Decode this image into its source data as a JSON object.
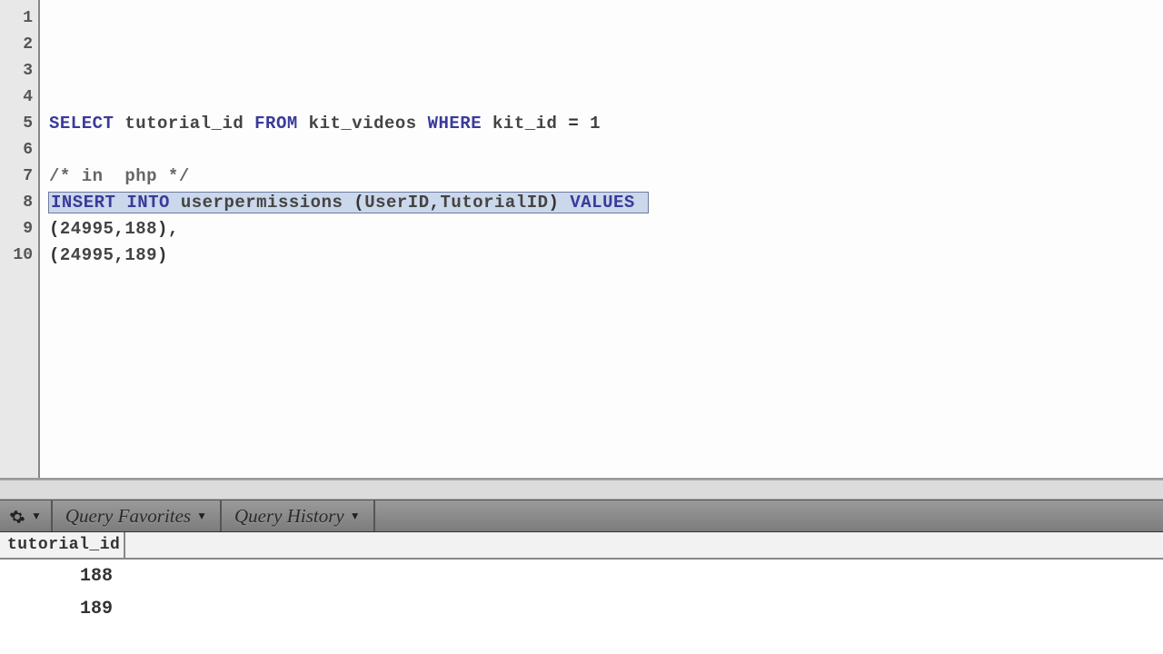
{
  "editor": {
    "lines": [
      {
        "n": "1",
        "tokens": []
      },
      {
        "n": "2",
        "tokens": []
      },
      {
        "n": "3",
        "tokens": []
      },
      {
        "n": "4",
        "tokens": []
      },
      {
        "n": "5",
        "tokens": [
          {
            "t": "SELECT",
            "c": "kw"
          },
          {
            "t": " ",
            "c": ""
          },
          {
            "t": "tutorial_id",
            "c": "ident"
          },
          {
            "t": " ",
            "c": ""
          },
          {
            "t": "FROM",
            "c": "kw"
          },
          {
            "t": " ",
            "c": ""
          },
          {
            "t": "kit_videos",
            "c": "ident"
          },
          {
            "t": " ",
            "c": ""
          },
          {
            "t": "WHERE",
            "c": "kw"
          },
          {
            "t": " ",
            "c": ""
          },
          {
            "t": "kit_id",
            "c": "ident"
          },
          {
            "t": " = ",
            "c": ""
          },
          {
            "t": "1",
            "c": "num"
          }
        ]
      },
      {
        "n": "6",
        "tokens": []
      },
      {
        "n": "7",
        "tokens": [
          {
            "t": "/* in  php */",
            "c": "comment"
          }
        ]
      },
      {
        "n": "8",
        "selected": true,
        "tokens": [
          {
            "t": "INSERT",
            "c": "kw"
          },
          {
            "t": " ",
            "c": ""
          },
          {
            "t": "INTO",
            "c": "kw"
          },
          {
            "t": " ",
            "c": ""
          },
          {
            "t": "userpermissions",
            "c": "ident"
          },
          {
            "t": " (",
            "c": ""
          },
          {
            "t": "UserID",
            "c": "ident"
          },
          {
            "t": ",",
            "c": ""
          },
          {
            "t": "TutorialID",
            "c": "ident"
          },
          {
            "t": ") ",
            "c": ""
          },
          {
            "t": "VALUES",
            "c": "kw"
          },
          {
            "t": " ",
            "c": ""
          }
        ]
      },
      {
        "n": "9",
        "tokens": [
          {
            "t": "(",
            "c": ""
          },
          {
            "t": "24995",
            "c": "num"
          },
          {
            "t": ",",
            "c": ""
          },
          {
            "t": "188",
            "c": "num"
          },
          {
            "t": "),",
            "c": ""
          }
        ]
      },
      {
        "n": "10",
        "tokens": [
          {
            "t": "(",
            "c": ""
          },
          {
            "t": "24995",
            "c": "num"
          },
          {
            "t": ",",
            "c": ""
          },
          {
            "t": "189",
            "c": "num"
          },
          {
            "t": ")",
            "c": ""
          }
        ]
      }
    ]
  },
  "toolbar": {
    "favorites": "Query Favorites",
    "history": "Query History"
  },
  "results": {
    "columns": [
      "tutorial_id"
    ],
    "rows": [
      {
        "tutorial_id": "188"
      },
      {
        "tutorial_id": "189"
      }
    ]
  }
}
